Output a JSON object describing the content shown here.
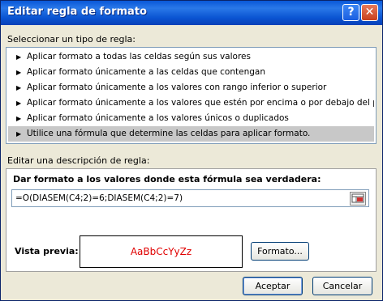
{
  "window": {
    "title": "Editar regla de formato",
    "help_glyph": "?",
    "close_glyph": "✕"
  },
  "rule_type": {
    "label": "Seleccionar un tipo de regla:",
    "items": [
      "Aplicar formato a todas las celdas según sus valores",
      "Aplicar formato únicamente a las celdas que contengan",
      "Aplicar formato únicamente a los valores con rango inferior o superior",
      "Aplicar formato únicamente a los valores que estén por encima o por debajo del promedio",
      "Aplicar formato únicamente a los valores únicos o duplicados",
      "Utilice una fórmula que determine las celdas para aplicar formato."
    ],
    "selected_index": 5,
    "arrow_glyph": "▶"
  },
  "description": {
    "label": "Editar una descripción de regla:",
    "formula_caption": "Dar formato a los valores donde esta fórmula sea verdadera:",
    "formula_value": "=O(DIASEM(C4;2)=6;DIASEM(C4;2)=7)",
    "preview_label": "Vista previa:",
    "preview_sample": "AaBbCcYyZz",
    "preview_color": "#e00000",
    "format_button": "Formato..."
  },
  "footer": {
    "accept": "Aceptar",
    "cancel": "Cancelar"
  }
}
